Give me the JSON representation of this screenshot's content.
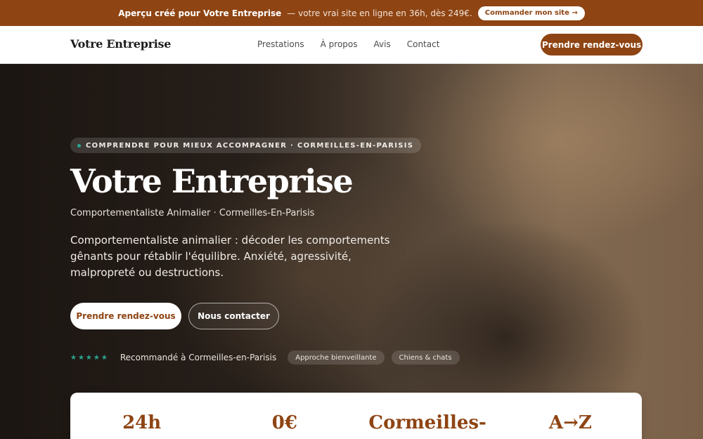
{
  "promo": {
    "preview": "Aperçu créé pour Votre Entreprise",
    "tagline": "— votre vrai site en ligne en 36h, dès 249€.",
    "cta": "Commander mon site →"
  },
  "nav": {
    "logo": "Votre Entreprise",
    "items": [
      "Prestations",
      "À propos",
      "Avis",
      "Contact"
    ],
    "cta": "Prendre rendez-vous"
  },
  "hero": {
    "badge": "COMPRENDRE POUR MIEUX ACCOMPAGNER · CORMEILLES-EN-PARISIS",
    "title": "Votre Entreprise",
    "subtitle": "Comportementaliste Animalier · Cormeilles-En-Parisis",
    "description": "Comportementaliste animalier : décoder les comportements gênants pour rétablir l'équilibre. Anxiété, agressivité, malpropreté ou destructions.",
    "primary_cta": "Prendre rendez-vous",
    "secondary_cta": "Nous contacter",
    "stars": "★★★★★",
    "recommended": "Recommandé à Cormeilles-en-Parisis",
    "pills": [
      "Approche bienveillante",
      "Chiens & chats"
    ]
  },
  "stats": [
    "24h",
    "0€",
    "Cormeilles-",
    "A→Z"
  ],
  "colors": {
    "brand": "#8e4413",
    "accent": "#2aa58f"
  }
}
